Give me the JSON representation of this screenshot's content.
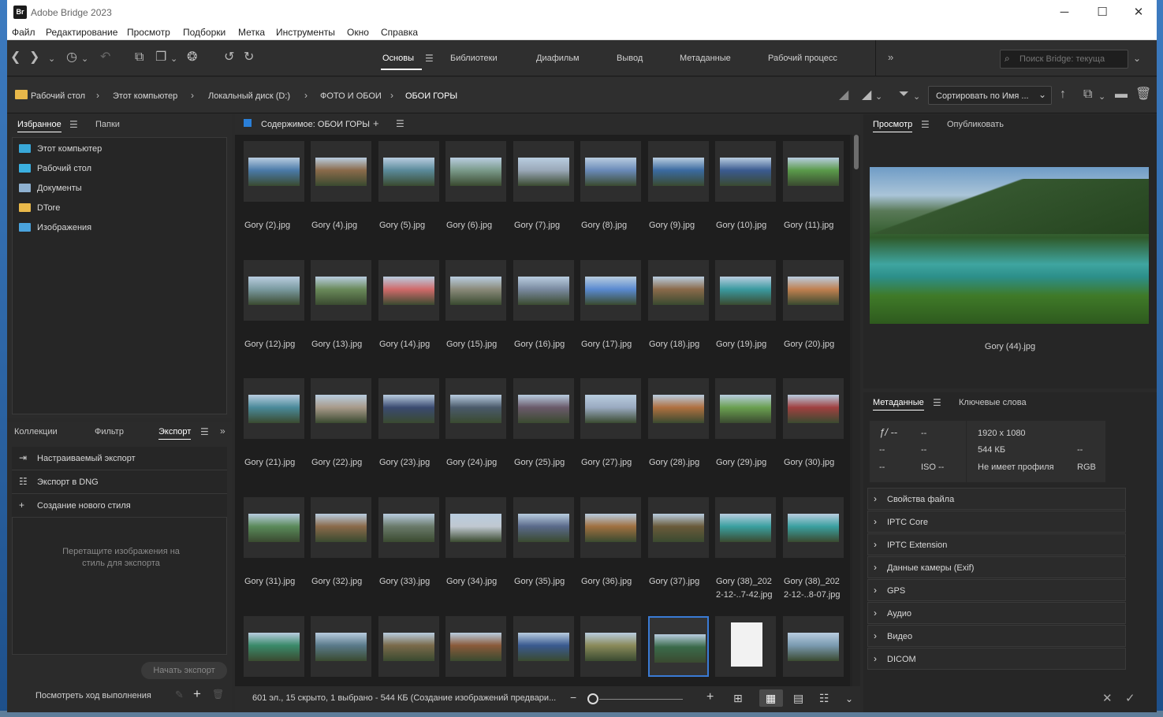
{
  "window": {
    "title": "Adobe Bridge 2023",
    "logo": "Br",
    "controls": {
      "minimize": "─",
      "maximize": "☐",
      "close": "✕"
    }
  },
  "menu": [
    "Файл",
    "Редактирование",
    "Просмотр",
    "Подборки",
    "Метка",
    "Инструменты",
    "Окно",
    "Справка"
  ],
  "workspaces": [
    "Основы",
    "Библиотеки",
    "Диафильм",
    "Вывод",
    "Метаданные",
    "Рабочий процесс"
  ],
  "search": {
    "placeholder": "Поиск Bridge: текуща"
  },
  "path": [
    "Рабочий стол",
    "Этот компьютер",
    "Локальный диск (D:)",
    "ФОТО И ОБОИ",
    "ОБОИ ГОРЫ"
  ],
  "sort": {
    "label": "Сортировать по Имя ..."
  },
  "left_panel": {
    "tabs": [
      "Избранное",
      "Папки"
    ],
    "favorites": [
      {
        "label": "Этот компьютер",
        "icon": "computer-icon",
        "color": "#39a8d8"
      },
      {
        "label": "Рабочий стол",
        "icon": "desktop-icon",
        "color": "#3bb0e0"
      },
      {
        "label": "Документы",
        "icon": "documents-icon",
        "color": "#8fb1d0"
      },
      {
        "label": "DTore",
        "icon": "folder-icon",
        "color": "#e8b84a"
      },
      {
        "label": "Изображения",
        "icon": "pictures-icon",
        "color": "#4aa3dd"
      }
    ]
  },
  "export_panel": {
    "tabs": [
      "Коллекции",
      "Фильтр",
      "Экспорт"
    ],
    "items": [
      "Настраиваемый экспорт",
      "Экспорт в DNG",
      "Создание нового стиля"
    ],
    "drop_hint": "Перетащите изображения на стиль для экспорта",
    "start_button": "Начать экспорт",
    "progress_link": "Посмотреть ход выполнения"
  },
  "content": {
    "header": "Содержимое: ОБОИ ГОРЫ",
    "accent": "#2a7fd8",
    "rows": [
      [
        "Gory (2).jpg",
        "Gory (4).jpg",
        "Gory (5).jpg",
        "Gory (6).jpg",
        "Gory (7).jpg",
        "Gory (8).jpg",
        "Gory (9).jpg",
        "Gory (10).jpg",
        "Gory (11).jpg"
      ],
      [
        "Gory (12).jpg",
        "Gory (13).jpg",
        "Gory (14).jpg",
        "Gory (15).jpg",
        "Gory (16).jpg",
        "Gory (17).jpg",
        "Gory (18).jpg",
        "Gory (19).jpg",
        "Gory (20).jpg"
      ],
      [
        "Gory (21).jpg",
        "Gory (22).jpg",
        "Gory (23).jpg",
        "Gory (24).jpg",
        "Gory (25).jpg",
        "Gory (27).jpg",
        "Gory (28).jpg",
        "Gory (29).jpg",
        "Gory (30).jpg"
      ],
      [
        "Gory (31).jpg",
        "Gory (32).jpg",
        "Gory (33).jpg",
        "Gory (34).jpg",
        "Gory (35).jpg",
        "Gory (36).jpg",
        "Gory (37).jpg",
        "Gory (38)_202 2-12-..7-42.jpg",
        "Gory (38)_202 2-12-..8-07.jpg"
      ],
      [
        "",
        "",
        "",
        "",
        "",
        "",
        "",
        "",
        ""
      ]
    ],
    "thumb_colors": [
      [
        "#4a7aa8",
        "#8a6a4a",
        "#5a8a9a",
        "#7a9a8a",
        "#9aa8b8",
        "#6a8ab8",
        "#3a6aa0",
        "#3a5a90",
        "#5a9a4a"
      ],
      [
        "#7a9aa0",
        "#6a8a5a",
        "#d06a6a",
        "#8a8a7a",
        "#7a8aa0",
        "#5a8ad0",
        "#8a6a4a",
        "#3a9aa0",
        "#c08050"
      ],
      [
        "#4a8a9a",
        "#a89a8a",
        "#3a4a70",
        "#4a5a6a",
        "#6a5a6a",
        "#9aaac0",
        "#b07040",
        "#6aa050",
        "#a04040"
      ],
      [
        "#5a8a5a",
        "#8a6a4a",
        "#6a7a6a",
        "#c0c8d0",
        "#5a6a8a",
        "#a07040",
        "#6a5a3a",
        "#3aa0a0",
        "#3aa0a0"
      ],
      [
        "#3a8a6a",
        "#5a7a8a",
        "#7a6a4a",
        "#8a5a3a",
        "#3a5a90",
        "#8a8a5a",
        "#3a6a4a",
        "#f2f2f2",
        "#7a9ab0"
      ]
    ],
    "selected_index": [
      4,
      6
    ],
    "scroll_fraction": 0.0,
    "status": "601 эл., 15 скрыто, 1 выбрано - 544 КБ (Создание изображений предвари...",
    "zoom_fraction": 0.0
  },
  "preview_panel": {
    "tabs": [
      "Просмотр",
      "Опубликовать"
    ],
    "caption": "Gory (44).jpg"
  },
  "metadata_panel": {
    "tabs": [
      "Метаданные",
      "Ключевые слова"
    ],
    "camera": {
      "aperture": "ƒ/ --",
      "shutter": "--",
      "r2c1": "--",
      "r2c2": "--",
      "r3c1": "--",
      "iso": "ISO --"
    },
    "file": {
      "dimensions": "1920 x 1080",
      "size": "544 КБ",
      "size_extra": "--",
      "profile": "Не имеет профиля",
      "mode": "RGB"
    },
    "sections": [
      "Свойства файла",
      "IPTC Core",
      "IPTC Extension",
      "Данные камеры (Exif)",
      "GPS",
      "Аудио",
      "Видео",
      "DICOM"
    ]
  }
}
